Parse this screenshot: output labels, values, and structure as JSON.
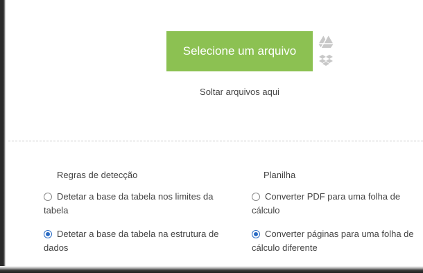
{
  "upload": {
    "select_button_label": "Selecione um arquivo",
    "drop_text": "Soltar arquivos aqui",
    "cloud_icons": [
      "google-drive-icon",
      "dropbox-icon"
    ]
  },
  "detection": {
    "title": "Regras de detecção",
    "options": [
      {
        "label": "Detetar a base da tabela nos limites da tabela",
        "selected": false
      },
      {
        "label": "Detetar a base da tabela na estrutura de dados",
        "selected": true
      }
    ]
  },
  "spreadsheet": {
    "title": "Planilha",
    "options": [
      {
        "label": "Converter PDF para uma folha de cálculo",
        "selected": false
      },
      {
        "label": "Converter páginas para uma folha de cálculo diferente",
        "selected": true
      }
    ]
  },
  "colors": {
    "button_green": "#8cc152",
    "radio_selected": "#2b6cc4",
    "text": "#444444"
  }
}
